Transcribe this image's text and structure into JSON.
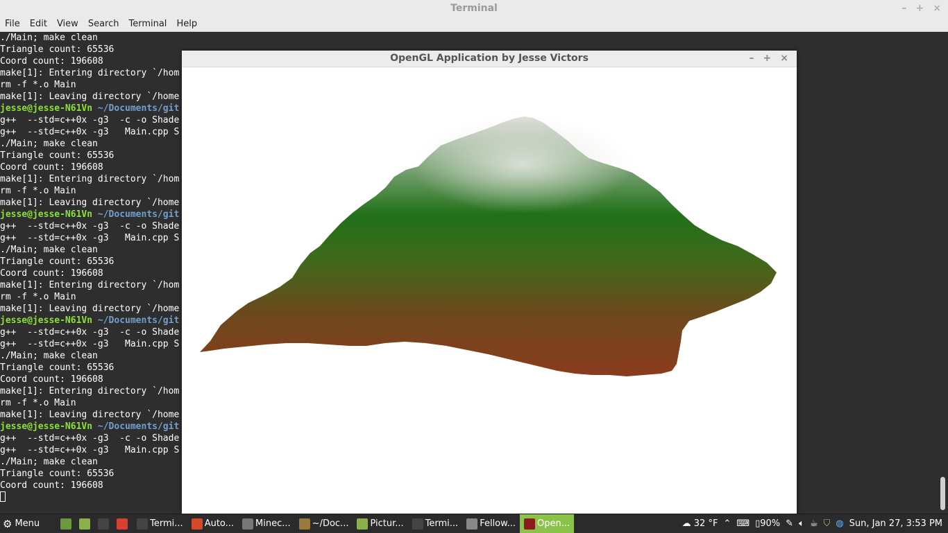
{
  "terminal": {
    "title": "Terminal",
    "controls": [
      "–",
      "+",
      "×"
    ],
    "menu": [
      "File",
      "Edit",
      "View",
      "Search",
      "Terminal",
      "Help"
    ],
    "lines": [
      {
        "text": "./Main; make clean"
      },
      {
        "text": "Triangle count: 65536"
      },
      {
        "text": "Coord count: 196608"
      },
      {
        "text": "make[1]: Entering directory `/hom"
      },
      {
        "text": "rm -f *.o Main"
      },
      {
        "text": "make[1]: Leaving directory `/home"
      },
      {
        "user": "jesse@jesse-N61Vn",
        "path": " ~/Documents/git"
      },
      {
        "text": "g++  --std=c++0x -g3  -c -o Shade"
      },
      {
        "text": "g++  --std=c++0x -g3   Main.cpp S"
      },
      {
        "text": "./Main; make clean"
      },
      {
        "text": "Triangle count: 65536"
      },
      {
        "text": "Coord count: 196608"
      },
      {
        "text": "make[1]: Entering directory `/hom"
      },
      {
        "text": "rm -f *.o Main"
      },
      {
        "text": "make[1]: Leaving directory `/home"
      },
      {
        "user": "jesse@jesse-N61Vn",
        "path": " ~/Documents/git"
      },
      {
        "text": "g++  --std=c++0x -g3  -c -o Shade"
      },
      {
        "text": "g++  --std=c++0x -g3   Main.cpp S"
      },
      {
        "text": "./Main; make clean"
      },
      {
        "text": "Triangle count: 65536"
      },
      {
        "text": "Coord count: 196608"
      },
      {
        "text": "make[1]: Entering directory `/hom"
      },
      {
        "text": "rm -f *.o Main"
      },
      {
        "text": "make[1]: Leaving directory `/home"
      },
      {
        "user": "jesse@jesse-N61Vn",
        "path": " ~/Documents/git"
      },
      {
        "text": "g++  --std=c++0x -g3  -c -o Shade"
      },
      {
        "text": "g++  --std=c++0x -g3   Main.cpp S"
      },
      {
        "text": "./Main; make clean"
      },
      {
        "text": "Triangle count: 65536"
      },
      {
        "text": "Coord count: 196608"
      },
      {
        "text": "make[1]: Entering directory `/hom"
      },
      {
        "text": "rm -f *.o Main"
      },
      {
        "text": "make[1]: Leaving directory `/home"
      },
      {
        "user": "jesse@jesse-N61Vn",
        "path": " ~/Documents/git"
      },
      {
        "text": "g++  --std=c++0x -g3  -c -o Shade"
      },
      {
        "text": "g++  --std=c++0x -g3   Main.cpp S"
      },
      {
        "text": "./Main; make clean"
      },
      {
        "text": "Triangle count: 65536"
      },
      {
        "text": "Coord count: 196608"
      }
    ],
    "colors": {
      "user": "#8ae234",
      "path": "#729fcf",
      "background": "#2e2e2e"
    }
  },
  "gl_window": {
    "title": "OpenGL Application by Jesse Victors",
    "controls": [
      "–",
      "+",
      "×"
    ],
    "colors": {
      "peak": "#e0e0dc",
      "mid": "#217019",
      "base": "#8b3b1e"
    }
  },
  "taskbar": {
    "menu_label": "Menu",
    "launchers": [
      {
        "icon": "show-desktop-icon",
        "color": "#6a9a3a"
      },
      {
        "icon": "files-icon",
        "color": "#8bb04e"
      },
      {
        "icon": "terminal-icon",
        "color": "#444444"
      },
      {
        "icon": "chrome-icon",
        "color": "#d9402f"
      }
    ],
    "windows": [
      {
        "label": "Termi...",
        "icon": "terminal-icon",
        "color": "#444444",
        "active": false
      },
      {
        "label": "Auto...",
        "icon": "shield-app-icon",
        "color": "#d44a2a",
        "active": false
      },
      {
        "label": "Minec...",
        "icon": "minecraft-icon",
        "color": "#777777",
        "active": false
      },
      {
        "label": "~/Doc...",
        "icon": "folder-icon",
        "color": "#9a7a3a",
        "active": false
      },
      {
        "label": "Pictur...",
        "icon": "folder-icon",
        "color": "#8bb04e",
        "active": false
      },
      {
        "label": "Termi...",
        "icon": "terminal-icon",
        "color": "#444444",
        "active": false
      },
      {
        "label": "Fellow...",
        "icon": "starred-icon",
        "color": "#888888",
        "active": false
      },
      {
        "label": "Open...",
        "icon": "opengl-icon",
        "color": "#8b1a1a",
        "active": true
      }
    ],
    "weather": "32 °F",
    "battery": "90%",
    "clock": "Sun, Jan 27,  3:53 PM"
  }
}
